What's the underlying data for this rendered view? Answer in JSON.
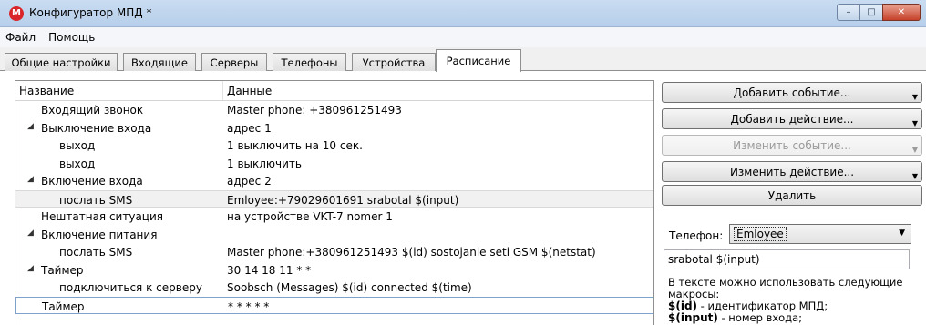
{
  "window": {
    "title": "Конфигуратор МПД *",
    "icon_letter": "M",
    "buttons": [
      "minimize-icon",
      "maximize-icon",
      "close-icon"
    ]
  },
  "menu": [
    "Файл",
    "Помощь"
  ],
  "tabs": [
    {
      "label": "Общие настройки",
      "active": false
    },
    {
      "label": "Входящие",
      "active": false
    },
    {
      "label": "Серверы",
      "active": false
    },
    {
      "label": "Телефоны",
      "active": false
    },
    {
      "label": "Устройства",
      "active": false
    },
    {
      "label": "Расписание",
      "active": true
    }
  ],
  "tree": {
    "columns": [
      "Название",
      "Данные"
    ],
    "rows": [
      {
        "level": 0,
        "expander": false,
        "name": "Входящий звонок",
        "data": "Master phone: +380961251493"
      },
      {
        "level": 0,
        "expander": true,
        "name": "Выключение входа",
        "data": "адрес 1"
      },
      {
        "level": 1,
        "expander": false,
        "name": "выход",
        "data": "1 выключить на 10 сек."
      },
      {
        "level": 1,
        "expander": false,
        "name": "выход",
        "data": "1 выключить"
      },
      {
        "level": 0,
        "expander": true,
        "name": "Включение входа",
        "data": "адрес 2"
      },
      {
        "level": 1,
        "expander": false,
        "name": "послать SMS",
        "data": "Emloyee:+79029601691 srabotal $(input)",
        "state": "selected"
      },
      {
        "level": 0,
        "expander": false,
        "name": "Нештатная ситуация",
        "data": "на устройстве VKT-7 nomer 1"
      },
      {
        "level": 0,
        "expander": true,
        "name": "Включение питания",
        "data": ""
      },
      {
        "level": 1,
        "expander": false,
        "name": "послать SMS",
        "data": "Master phone:+380961251493 $(id) sostojanie seti GSM $(netstat)"
      },
      {
        "level": 0,
        "expander": true,
        "name": "Таймер",
        "data": "30 14 18 11 * *"
      },
      {
        "level": 1,
        "expander": false,
        "name": "подключиться к серверу",
        "data": "Soobsch (Messages) $(id) connected $(time)"
      },
      {
        "level": 0,
        "expander": false,
        "name": "Таймер",
        "data": "* * * * *",
        "state": "focused"
      }
    ]
  },
  "actions": {
    "add_event": "Добавить событие...",
    "add_action": "Добавить действие...",
    "edit_event": "Изменить событие...",
    "edit_action": "Изменить действие...",
    "delete": "Удалить"
  },
  "phone": {
    "label": "Телефон:",
    "selected": "Emloyee"
  },
  "message": {
    "value": "srabotal $(input)"
  },
  "help": {
    "intro": "В тексте можно использовать следующие макросы:",
    "macros": [
      {
        "macro": "$(id)",
        "desc": " - идентификатор МПД;"
      },
      {
        "macro": "$(input)",
        "desc": " - номер входа;"
      }
    ]
  },
  "colors": {
    "title_gradient": "#c9dcf1",
    "selection_row": "#f1f1f1",
    "focus_border": "#7da2ce",
    "close_button": "#c7422a",
    "app_icon": "#d9262b"
  }
}
